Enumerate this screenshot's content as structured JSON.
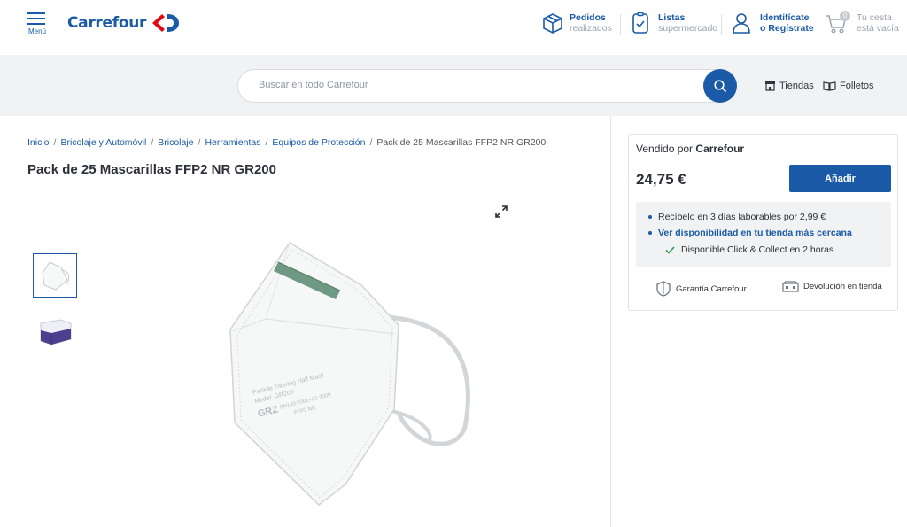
{
  "header": {
    "menu_label": "Menú",
    "logo_text": "Carrefour",
    "orders": {
      "title": "Pedidos",
      "subtitle": "realizados"
    },
    "lists": {
      "title": "Listas",
      "subtitle": "supermercado"
    },
    "account": {
      "title": "Identifícate",
      "subtitle": "o Regístrate"
    },
    "cart": {
      "count": "0",
      "title": "Tu cesta",
      "subtitle": "está vacía"
    }
  },
  "search": {
    "placeholder": "Buscar en todo Carrefour",
    "stores_label": "Tiendas",
    "leaflets_label": "Folletos"
  },
  "breadcrumb": {
    "items": [
      "Inicio",
      "Bricolaje y Automóvil",
      "Bricolaje",
      "Herramientas",
      "Equipos de Protección"
    ],
    "current": "Pack de 25 Mascarillas FFP2 NR GR200"
  },
  "product": {
    "title": "Pack de 25 Mascarillas FFP2 NR GR200",
    "mask_print": [
      "Particle Filtering Half Mask",
      "Model: GR200",
      "GRZ",
      "EN149:2001+A1:2009",
      "FFP2 NR"
    ]
  },
  "buybox": {
    "sold_prefix": "Vendido por",
    "seller": "Carrefour",
    "price": "24,75 €",
    "add_label": "Añadir",
    "delivery": "Recíbelo en 3 días laborables por 2,99 €",
    "availability_link": "Ver disponibilidad en tu tienda más cercana",
    "click_collect": "Disponible Click & Collect en 2 horas",
    "guarantee": "Garantía Carrefour",
    "returns": "Devolución en tienda"
  },
  "colors": {
    "brand_blue": "#1a5aa6",
    "brand_red": "#e30613",
    "check_green": "#2e9b4a",
    "band_gray": "#f1f2f3"
  }
}
